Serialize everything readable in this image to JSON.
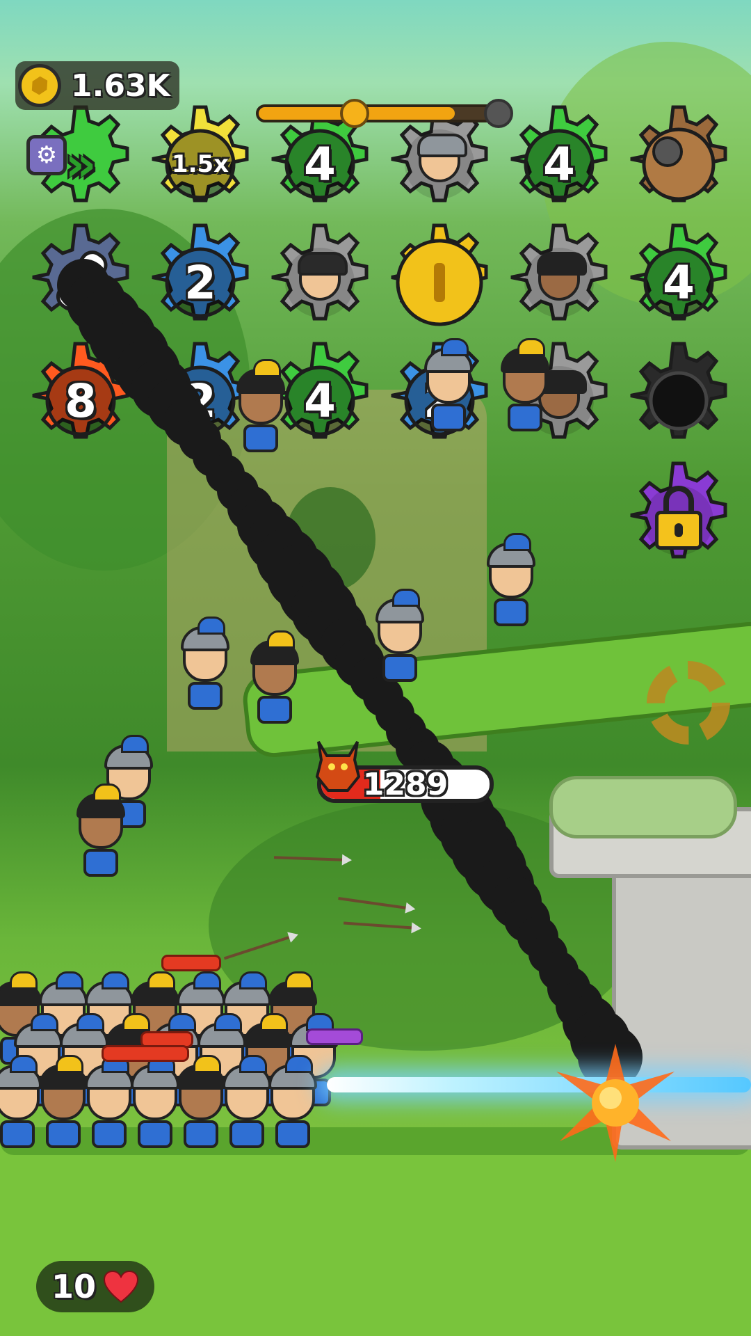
{
  "hud": {
    "coins": "1.63K",
    "lives": "10",
    "progress_fraction": 0.82,
    "progress_marker_fraction": 0.4
  },
  "gears": [
    {
      "row": 0,
      "col": 1,
      "color": "#f2e03a",
      "label": "1.5x",
      "kind": "speed"
    },
    {
      "row": 0,
      "col": 2,
      "color": "#3fcb3f",
      "label": "4",
      "kind": "number"
    },
    {
      "row": 0,
      "col": 3,
      "color": "#9a9a9a",
      "label": "",
      "kind": "roman-unit"
    },
    {
      "row": 0,
      "col": 4,
      "color": "#3fcb3f",
      "label": "4",
      "kind": "number"
    },
    {
      "row": 0,
      "col": 5,
      "color": "#9b6a3c",
      "label": "",
      "kind": "tnt"
    },
    {
      "row": 1,
      "col": 0,
      "color": "#596a93",
      "label": "",
      "kind": "rocket"
    },
    {
      "row": 1,
      "col": 1,
      "color": "#3b92e6",
      "label": "2",
      "kind": "number"
    },
    {
      "row": 1,
      "col": 2,
      "color": "#9a9a9a",
      "label": "",
      "kind": "tribal-unit"
    },
    {
      "row": 1,
      "col": 3,
      "color": "#f2c21a",
      "label": "",
      "kind": "coin"
    },
    {
      "row": 1,
      "col": 4,
      "color": "#9a9a9a",
      "label": "",
      "kind": "caveman-unit"
    },
    {
      "row": 1,
      "col": 5,
      "color": "#3fcb3f",
      "label": "4",
      "kind": "number"
    },
    {
      "row": 2,
      "col": 0,
      "color": "#ff5a1f",
      "label": "8",
      "kind": "number"
    },
    {
      "row": 2,
      "col": 1,
      "color": "#3b92e6",
      "label": "2",
      "kind": "number"
    },
    {
      "row": 2,
      "col": 2,
      "color": "#3fcb3f",
      "label": "4",
      "kind": "number"
    },
    {
      "row": 2,
      "col": 3,
      "color": "#3b92e6",
      "label": "2",
      "kind": "number"
    },
    {
      "row": 2,
      "col": 4,
      "color": "#9a9a9a",
      "label": "",
      "kind": "caveman-unit"
    },
    {
      "row": 2,
      "col": 5,
      "color": "#2a2a2a",
      "label": "",
      "kind": "empty"
    },
    {
      "row": 3,
      "col": 5,
      "color": "#8a3bd4",
      "label": "",
      "kind": "locked"
    }
  ],
  "boss": {
    "hp": "1289",
    "health_fraction": 0.35
  },
  "colors": {
    "accent": "#f2a411",
    "health": "#e22a1c",
    "beam": "#55c8ff",
    "grass": "#6fc23a"
  },
  "icons": {
    "settings": "gear-icon",
    "coin": "coin-icon",
    "life": "heart-icon",
    "lock": "lock-icon"
  }
}
